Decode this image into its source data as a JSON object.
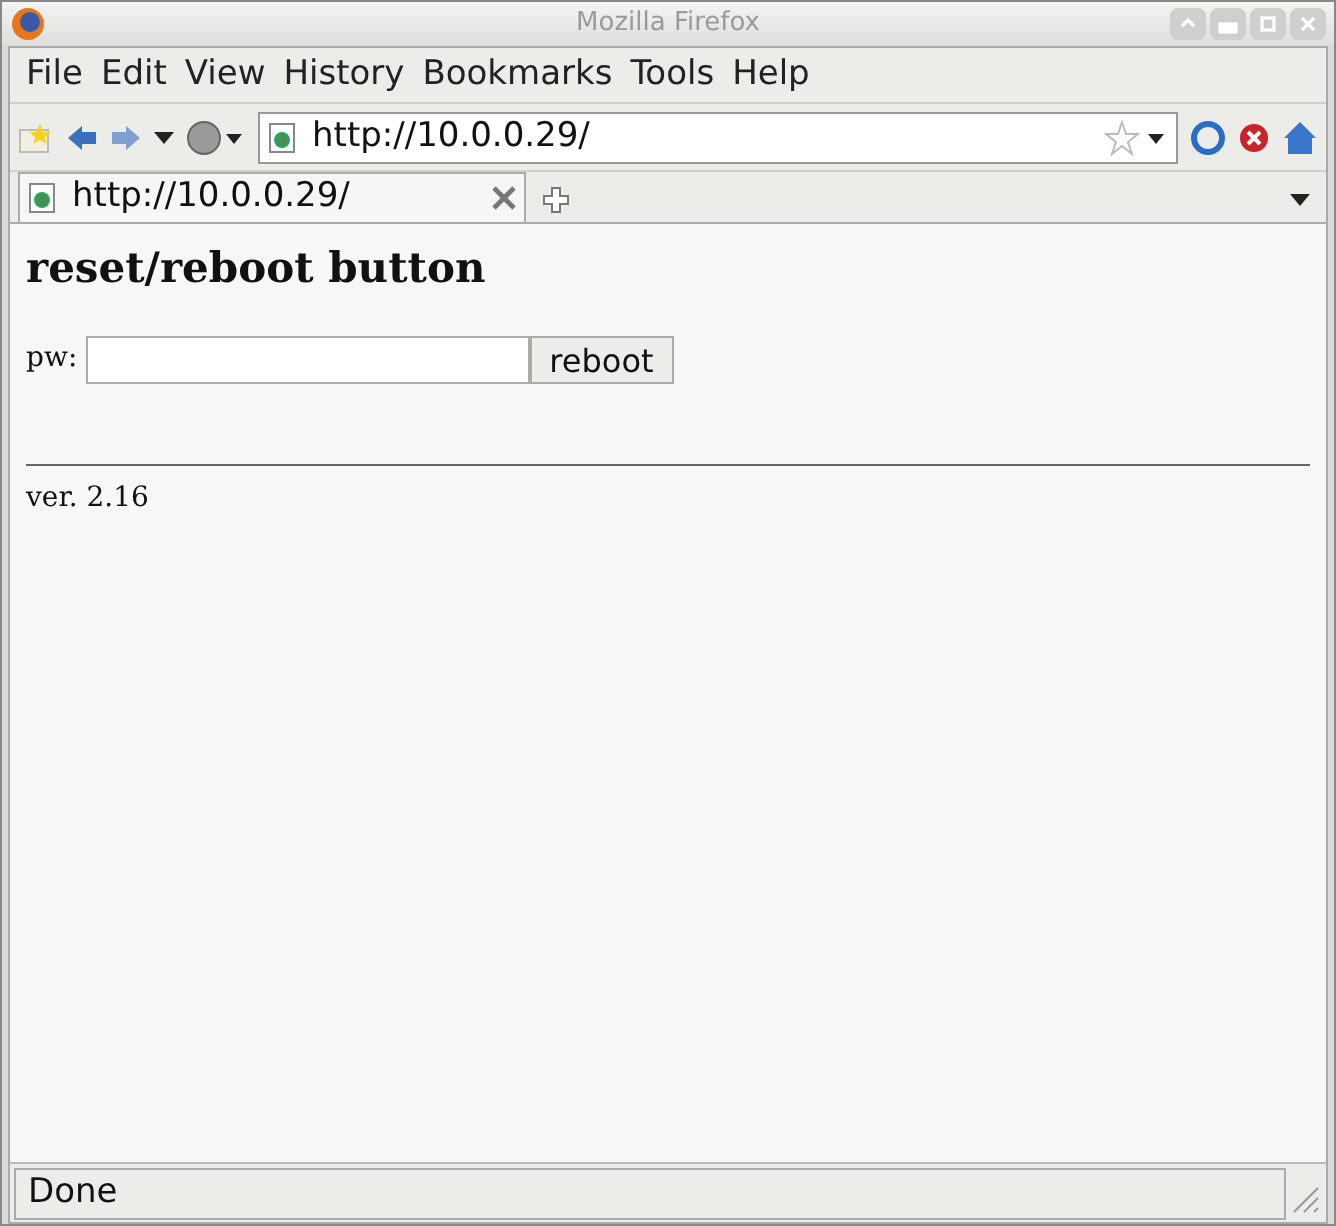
{
  "window": {
    "title": "Mozilla Firefox"
  },
  "menu": [
    "File",
    "Edit",
    "View",
    "History",
    "Bookmarks",
    "Tools",
    "Help"
  ],
  "address_bar": {
    "value": "http://10.0.0.29/"
  },
  "tabs": [
    {
      "label": "http://10.0.0.29/",
      "selected": true
    }
  ],
  "page": {
    "heading": "reset/reboot button",
    "field_label": "pw:",
    "button": "reboot",
    "version": "ver. 2.16"
  },
  "status_bar": "Done"
}
